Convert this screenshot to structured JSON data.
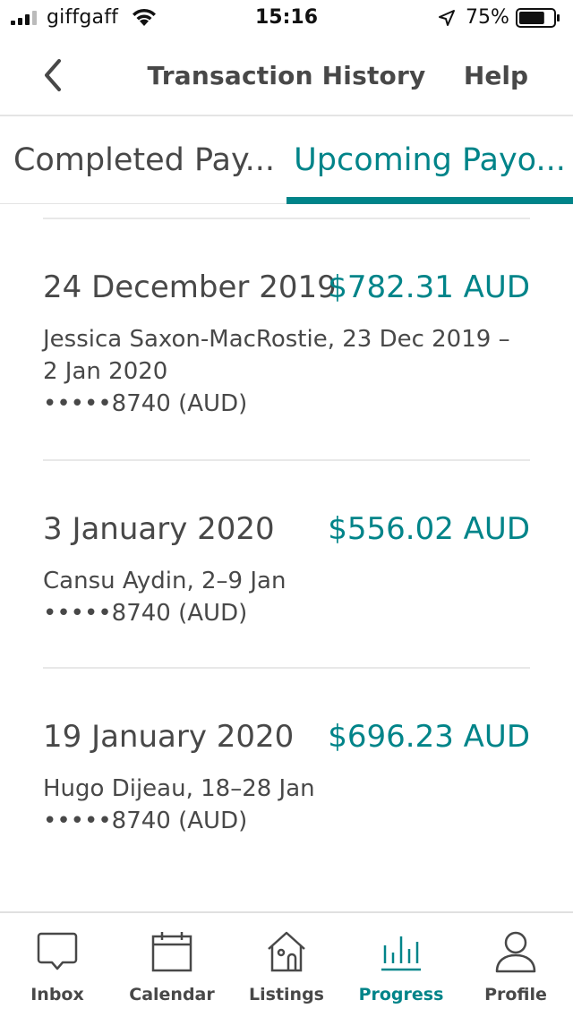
{
  "status_bar": {
    "carrier": "giffgaff",
    "time": "15:16",
    "battery_percent": "75%",
    "battery_level": 0.75
  },
  "nav": {
    "title": "Transaction History",
    "help_label": "Help",
    "back_icon": "chevron-left-icon"
  },
  "tabs": {
    "completed_label": "Completed Pay...",
    "upcoming_label": "Upcoming Payo...",
    "active": "upcoming"
  },
  "payouts": [
    {
      "date": "24 December 2019",
      "amount": "$782.31 AUD",
      "detail": "Jessica Saxon-MacRostie, 23 Dec 2019 – 2 Jan 2020",
      "account": "•••••8740 (AUD)"
    },
    {
      "date": "3 January 2020",
      "amount": "$556.02 AUD",
      "detail": "Cansu Aydin, 2–9 Jan",
      "account": "•••••8740 (AUD)"
    },
    {
      "date": "19 January 2020",
      "amount": "$696.23 AUD",
      "detail": "Hugo Dijeau, 18–28 Jan",
      "account": "•••••8740 (AUD)"
    }
  ],
  "tab_bar": {
    "items": [
      {
        "label": "Inbox",
        "icon": "speech-bubble-icon"
      },
      {
        "label": "Calendar",
        "icon": "calendar-icon"
      },
      {
        "label": "Listings",
        "icon": "house-icon"
      },
      {
        "label": "Progress",
        "icon": "bar-chart-icon"
      },
      {
        "label": "Profile",
        "icon": "person-icon"
      }
    ],
    "active": "Progress"
  },
  "colors": {
    "accent": "#008489",
    "text": "#484848",
    "divider": "#e8e8e8"
  }
}
